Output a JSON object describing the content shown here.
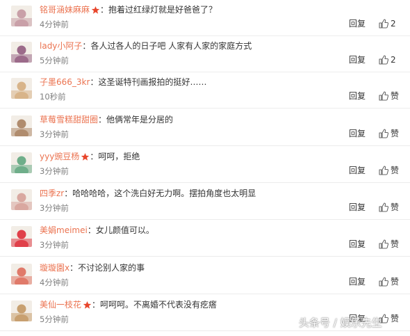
{
  "comments": [
    {
      "username": "铭哥涵妹麻麻",
      "has_vip_icon": true,
      "text": "抱着过红绿灯就是好爸爸了？",
      "time": "4分钟前",
      "reply_label": "回复",
      "like_label": "2",
      "avatar_color": "#c9a0a8",
      "name_color": "#eb7350"
    },
    {
      "username": "lady小阿子",
      "has_vip_icon": false,
      "text": "各人过各人的日子吧 人家有人家的家庭方式",
      "time": "5分钟前",
      "reply_label": "回复",
      "like_label": "2",
      "avatar_color": "#9c6b8a",
      "name_color": "#eb7350"
    },
    {
      "username": "子墨666_3kr",
      "has_vip_icon": false,
      "text": "这圣诞特刊画报拍的挺好……",
      "time": "10秒前",
      "reply_label": "回复",
      "like_label": "赞",
      "avatar_color": "#d8b48a",
      "name_color": "#eb7350"
    },
    {
      "username": "草莓雪糕甜甜圈",
      "has_vip_icon": false,
      "text": "他俩常年是分居的",
      "time": "3分钟前",
      "reply_label": "回复",
      "like_label": "赞",
      "avatar_color": "#b08c6e",
      "name_color": "#eb7350"
    },
    {
      "username": "yyy豌豆杨",
      "has_vip_icon": true,
      "text": "呵呵，拒绝",
      "time": "3分钟前",
      "reply_label": "回复",
      "like_label": "赞",
      "avatar_color": "#6fae8a",
      "name_color": "#eb7350"
    },
    {
      "username": "四季zr",
      "has_vip_icon": false,
      "text": "哈哈哈哈，这个洗白好无力啊。摆拍角度也太明显",
      "time": "3分钟前",
      "reply_label": "回复",
      "like_label": "赞",
      "avatar_color": "#d9a8a0",
      "name_color": "#eb7350"
    },
    {
      "username": "美娟meimei",
      "has_vip_icon": false,
      "text": "女儿颜值可以。",
      "time": "3分钟前",
      "reply_label": "回复",
      "like_label": "赞",
      "avatar_color": "#e0404a",
      "name_color": "#eb7350"
    },
    {
      "username": "璇璇園x",
      "has_vip_icon": false,
      "text": "不讨论别人家的事",
      "time": "4分钟前",
      "reply_label": "回复",
      "like_label": "赞",
      "avatar_color": "#e07a6a",
      "name_color": "#eb7350"
    },
    {
      "username": "美仙一枝花",
      "has_vip_icon": true,
      "text": "呵呵呵。不离婚不代表没有疙瘩",
      "time": "5分钟前",
      "reply_label": "回复",
      "like_label": "赞",
      "avatar_color": "#c8a070",
      "name_color": "#eb7350"
    }
  ],
  "watermark": "头条号 / 娱乐先生",
  "colors": {
    "username": "#eb7350",
    "text": "#333333",
    "time": "#808080",
    "vip_star": "#e8462c",
    "divider": "#ececec"
  },
  "icons": {
    "vip": "star-vip-icon",
    "like": "thumbs-up-icon"
  }
}
